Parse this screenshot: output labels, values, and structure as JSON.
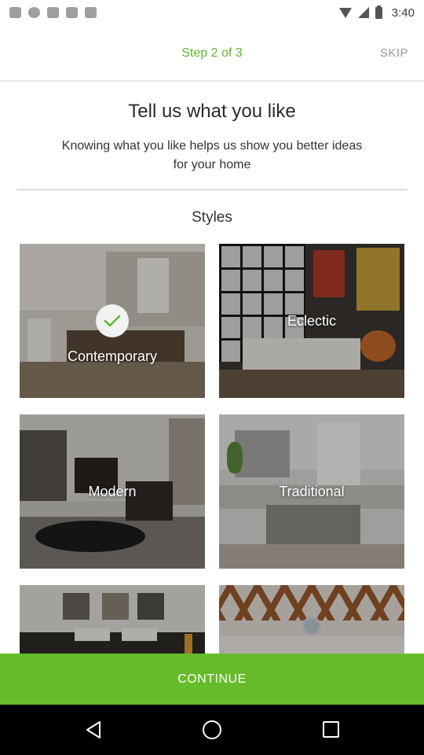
{
  "status_bar": {
    "time": "3:40",
    "left_icons": [
      "notification-icon",
      "notification-icon",
      "notification-icon",
      "notification-icon",
      "notification-icon"
    ],
    "right_icons": [
      "wifi-icon",
      "signal-icon",
      "battery-icon"
    ]
  },
  "header": {
    "step_label": "Step 2 of 3",
    "skip_label": "SKIP"
  },
  "intro": {
    "title": "Tell us what you like",
    "subtitle": "Knowing what you like helps us show you better ideas for your home"
  },
  "section_title": "Styles",
  "styles": [
    {
      "label": "Contemporary",
      "selected": true
    },
    {
      "label": "Eclectic",
      "selected": false
    },
    {
      "label": "Modern",
      "selected": false
    },
    {
      "label": "Traditional",
      "selected": false
    },
    {
      "label": "",
      "selected": false
    },
    {
      "label": "",
      "selected": false
    }
  ],
  "continue_label": "CONTINUE",
  "colors": {
    "accent": "#5cb92f",
    "continue_bg": "#66bb2a",
    "skip": "#9a9a9a"
  },
  "nav": [
    "back-icon",
    "home-icon",
    "recent-apps-icon"
  ]
}
